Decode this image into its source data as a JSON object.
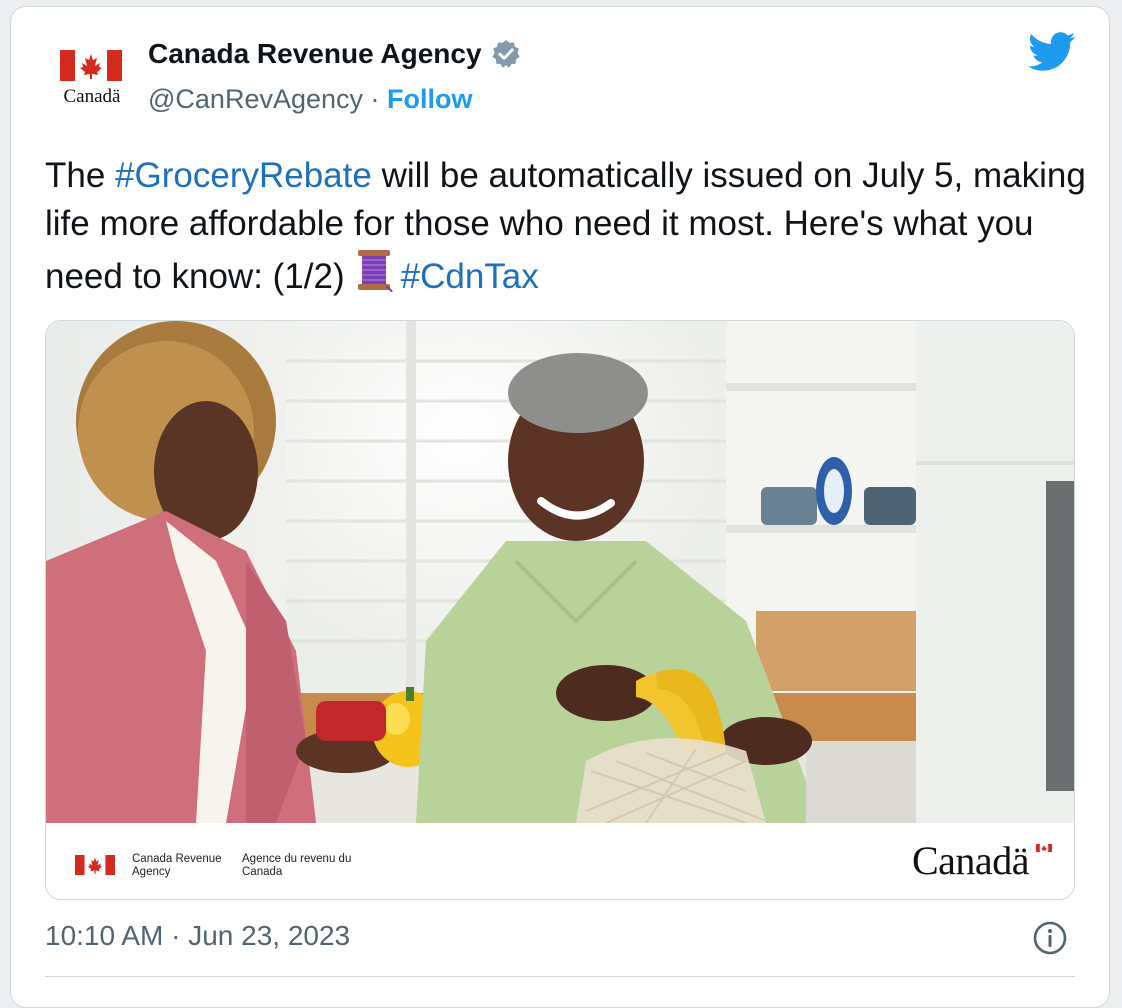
{
  "author": {
    "display_name": "Canada Revenue Agency",
    "handle": "@CanRevAgency",
    "separator": "·",
    "follow_label": "Follow",
    "verified": true,
    "avatar_wordmark": "Canadä"
  },
  "tweet": {
    "text_part1": "The ",
    "hashtag1": "#GroceryRebate",
    "text_part2": " will be automatically issued on July 5, making life more affordable for those who need it most. Here's what you need to know: (1/2)",
    "emoji_name": "spool-of-thread-icon",
    "hashtag2": "#CdnTax"
  },
  "media": {
    "footer_en": "Canada Revenue Agency",
    "footer_fr": "Agence du revenu du Canada",
    "wordmark": "Canadä"
  },
  "meta": {
    "time": "10:10 AM",
    "separator": "·",
    "date": "Jun 23, 2023"
  },
  "colors": {
    "link": "#1d9bf0",
    "hashtag": "#1d6fbf",
    "flag_red": "#d52b1e",
    "text": "#0f1419",
    "muted": "#536471"
  },
  "icons": [
    "verified-badge-icon",
    "twitter-bird-icon",
    "info-icon",
    "canada-flag-icon"
  ]
}
